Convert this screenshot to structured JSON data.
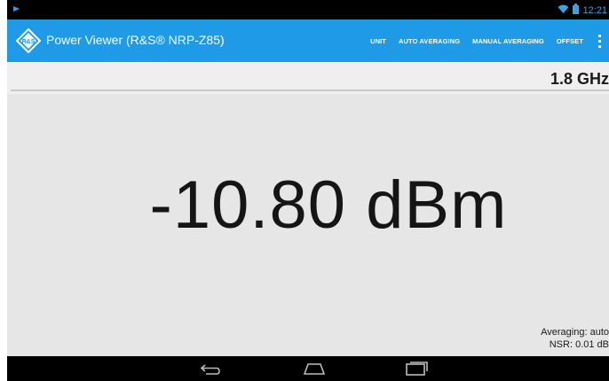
{
  "status_bar": {
    "time": "12:21",
    "icons": [
      "notification-icon",
      "wifi-icon",
      "battery-icon"
    ]
  },
  "action_bar": {
    "title": "Power Viewer (R&S® NRP-Z85)",
    "logo_text": "R&S",
    "actions": [
      {
        "label": "UNIT"
      },
      {
        "label": "AUTO AVERAGING"
      },
      {
        "label": "MANUAL AVERAGING"
      },
      {
        "label": "OFFSET"
      }
    ],
    "overflow_icon": "overflow-menu-icon"
  },
  "measurement": {
    "frequency": "1.8 GHz",
    "reading": "-10.80 dBm",
    "averaging": "Averaging: auto",
    "nsr": "NSR: 0.01 dB"
  },
  "nav_bar": {
    "buttons": [
      "back-icon",
      "home-icon",
      "recents-icon"
    ]
  },
  "colors": {
    "accent": "#1e9ae6",
    "background": "#e6e6e6",
    "bars": "#000000"
  }
}
